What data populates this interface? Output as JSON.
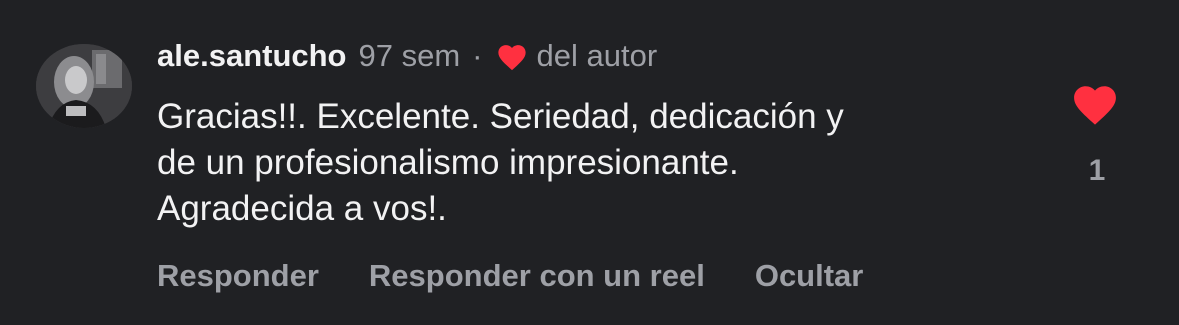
{
  "comment": {
    "username": "ale.santucho",
    "time_ago": "97 sem",
    "separator": "·",
    "author_like_label": "del autor",
    "text_lines": [
      "Gracias!!. Excelente. Seriedad, dedicación y",
      "de un profesionalismo impresionante.",
      "Agradecida a vos!."
    ],
    "like_count": "1",
    "like_icon": "heart-filled",
    "accent_color": "#ff3040"
  },
  "actions": {
    "reply": "Responder",
    "reply_reel": "Responder con un reel",
    "hide": "Ocultar"
  }
}
